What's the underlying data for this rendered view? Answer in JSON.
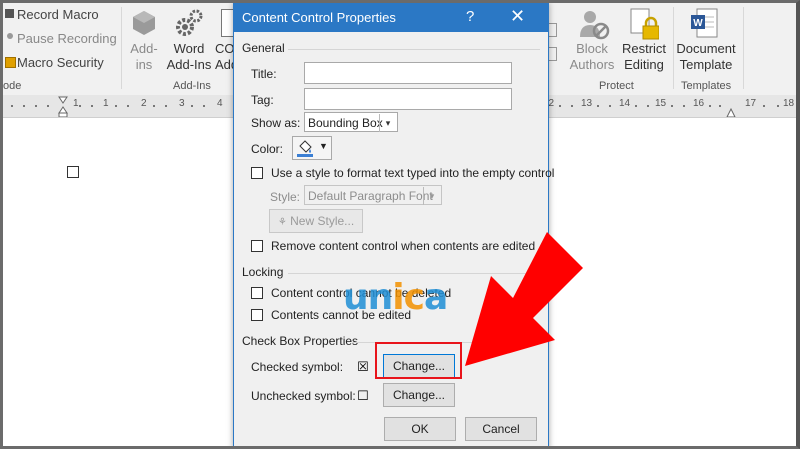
{
  "ribbon": {
    "record_macro": "Record Macro",
    "pause_recording": "Pause Recording",
    "macro_security": "Macro Security",
    "code_group": "ode",
    "addins_1": "Add-",
    "addins_2": "ins",
    "word_addins_1": "Word",
    "word_addins_2": "Add-Ins",
    "com_addins_1": "CO",
    "com_addins_2": "Add",
    "addins_group": "Add-Ins",
    "block_authors_1": "Block",
    "block_authors_2": "Authors",
    "restrict_editing_1": "Restrict",
    "restrict_editing_2": "Editing",
    "protect_group": "Protect",
    "document_template_1": "Document",
    "document_template_2": "Template",
    "templates_group": "Templates"
  },
  "ruler": {
    "ticks_left": [
      "1",
      "1",
      "2",
      "3",
      "4"
    ],
    "ticks_right": [
      "12",
      "13",
      "14",
      "15",
      "16",
      "17",
      "18"
    ]
  },
  "dialog": {
    "title": "Content Control Properties",
    "help": "?",
    "close": "✕",
    "general_section": "General",
    "title_label": "Title:",
    "title_value": "",
    "tag_label": "Tag:",
    "tag_value": "",
    "show_as_label": "Show as:",
    "show_as_value": "Bounding Box",
    "color_label": "Color:",
    "use_style_label": "Use a style to format text typed into the empty control",
    "style_label": "Style:",
    "style_value": "Default Paragraph Font",
    "new_style_button": "New Style...",
    "remove_control_label": "Remove content control when contents are edited",
    "locking_section": "Locking",
    "cannot_delete_label": "Content control cannot be deleted",
    "cannot_edit_label": "Contents cannot be edited",
    "checkbox_section": "Check Box Properties",
    "checked_symbol_label": "Checked symbol:",
    "checked_symbol_char": "☒",
    "unchecked_symbol_label": "Unchecked symbol:",
    "unchecked_symbol_char": "☐",
    "change_button_1": "Change...",
    "change_button_2": "Change...",
    "ok_button": "OK",
    "cancel_button": "Cancel"
  },
  "watermark": {
    "text": "unica"
  },
  "colors": {
    "titlebar": "#2b78c5",
    "highlight_red": "#e8141b",
    "arrow_red": "#ff0000",
    "unica_blue": "#1f8fd6",
    "unica_orange": "#f39200"
  }
}
